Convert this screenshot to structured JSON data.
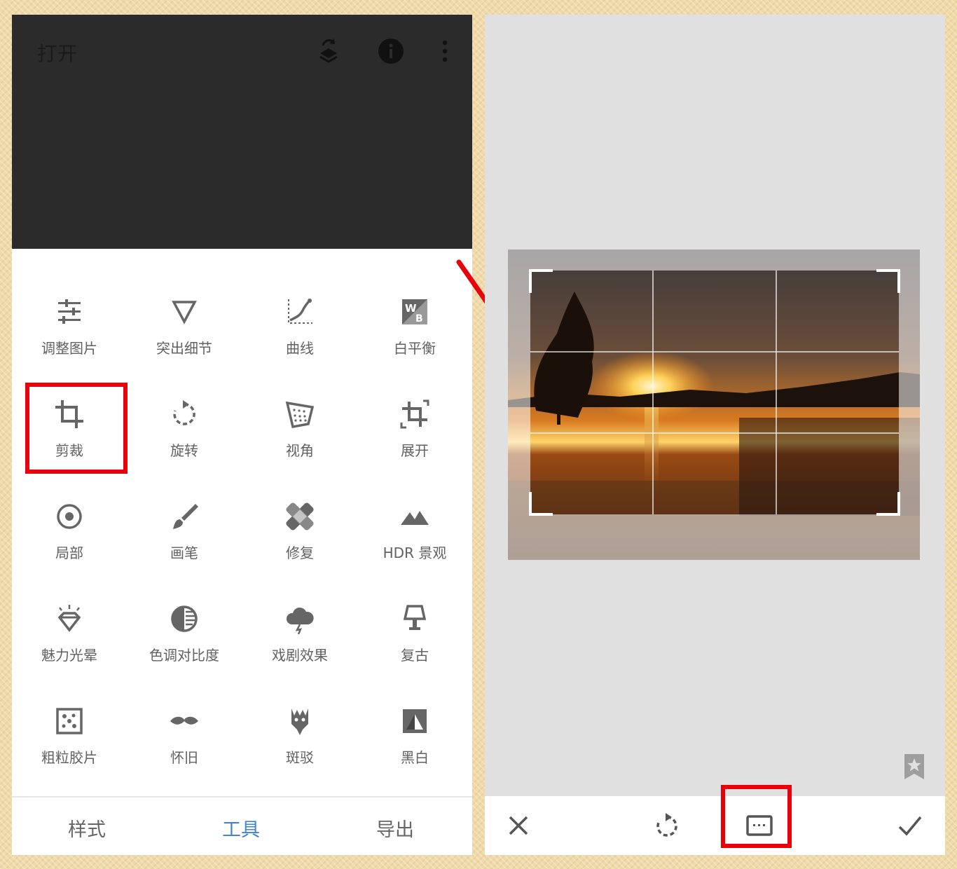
{
  "left_screen": {
    "header": {
      "open_label": "打开",
      "icons": [
        "layers-stack-icon",
        "info-icon",
        "more-vertical-icon"
      ]
    },
    "tools": [
      {
        "label": "调整图片",
        "icon": "tune-sliders-icon"
      },
      {
        "label": "突出细节",
        "icon": "details-triangle-icon"
      },
      {
        "label": "曲线",
        "icon": "curves-icon"
      },
      {
        "label": "白平衡",
        "icon": "white-balance-icon"
      },
      {
        "label": "剪裁",
        "icon": "crop-icon"
      },
      {
        "label": "旋转",
        "icon": "rotate-icon"
      },
      {
        "label": "视角",
        "icon": "perspective-icon"
      },
      {
        "label": "展开",
        "icon": "expand-icon"
      },
      {
        "label": "局部",
        "icon": "selective-target-icon"
      },
      {
        "label": "画笔",
        "icon": "brush-icon"
      },
      {
        "label": "修复",
        "icon": "healing-bandage-icon"
      },
      {
        "label": "HDR 景观",
        "icon": "mountains-icon"
      },
      {
        "label": "魅力光晕",
        "icon": "glamour-diamond-icon"
      },
      {
        "label": "色调对比度",
        "icon": "tonal-contrast-icon"
      },
      {
        "label": "戏剧效果",
        "icon": "drama-cloud-icon"
      },
      {
        "label": "复古",
        "icon": "vintage-lamp-icon"
      },
      {
        "label": "粗粒胶片",
        "icon": "grainy-film-icon"
      },
      {
        "label": "怀旧",
        "icon": "mustache-icon"
      },
      {
        "label": "斑驳",
        "icon": "grunge-icon"
      },
      {
        "label": "黑白",
        "icon": "black-white-icon"
      }
    ],
    "bottom_nav": [
      {
        "label": "样式",
        "active": false
      },
      {
        "label": "工具",
        "active": true
      },
      {
        "label": "导出",
        "active": false
      }
    ],
    "highlight_color": "#e8000b",
    "active_tab_color": "#3f84d8"
  },
  "right_screen": {
    "photo": "sunset-over-lake",
    "crop_grid": "rule-of-thirds",
    "bottom_bar_icons": [
      "close-icon",
      "rotate-crop-icon",
      "aspect-ratio-icon",
      "check-icon"
    ],
    "bookmark_icon": "bookmark-star-icon"
  }
}
